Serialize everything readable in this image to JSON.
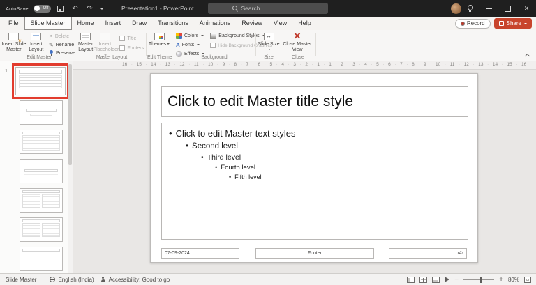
{
  "titlebar": {
    "autosave_label": "AutoSave",
    "autosave_state": "Off",
    "document_title": "Presentation1 - PowerPoint",
    "search_placeholder": "Search"
  },
  "tabs": {
    "items": [
      "File",
      "Slide Master",
      "Home",
      "Insert",
      "Draw",
      "Transitions",
      "Animations",
      "Review",
      "View",
      "Help"
    ],
    "active": "Slide Master",
    "record_label": "Record",
    "share_label": "Share"
  },
  "ribbon": {
    "edit_master": {
      "label": "Edit Master",
      "insert_slide_master": "Insert Slide Master",
      "insert_layout": "Insert Layout",
      "delete": "Delete",
      "rename": "Rename",
      "preserve": "Preserve"
    },
    "master_layout": {
      "label": "Master Layout",
      "master_layout": "Master Layout",
      "insert_placeholder": "Insert Placeholder",
      "title_checkbox": "Title",
      "footers_checkbox": "Footers"
    },
    "edit_theme": {
      "label": "Edit Theme",
      "themes": "Themes"
    },
    "background": {
      "label": "Background",
      "colors": "Colors",
      "fonts": "Fonts",
      "effects": "Effects",
      "background_styles": "Background Styles",
      "hide_background_graphics": "Hide Background Graphics"
    },
    "size": {
      "label": "Size",
      "slide_size": "Slide Size"
    },
    "close": {
      "label": "Close",
      "close_master_view": "Close Master View"
    }
  },
  "sidebar": {
    "selected_slide_number": "1",
    "thumbnails": [
      {
        "kind": "master",
        "selected": true
      },
      {
        "kind": "title",
        "selected": false
      },
      {
        "kind": "content",
        "selected": false
      },
      {
        "kind": "section",
        "selected": false
      },
      {
        "kind": "two-content",
        "selected": false
      },
      {
        "kind": "comparison",
        "selected": false
      },
      {
        "kind": "title-only",
        "selected": false
      }
    ]
  },
  "ruler": {
    "numbers": [
      16,
      15,
      14,
      13,
      12,
      11,
      10,
      9,
      8,
      7,
      6,
      5,
      4,
      3,
      2,
      1,
      1,
      2,
      3,
      4,
      5,
      6,
      7,
      8,
      9,
      10,
      11,
      12,
      13,
      14,
      15,
      16
    ],
    "dot": "·"
  },
  "slide": {
    "title_placeholder": "Click to edit Master title style",
    "bullet_glyph": "•",
    "body_levels": [
      "Click to edit Master text styles",
      "Second level",
      "Third level",
      "Fourth level",
      "Fifth level"
    ],
    "date": "07-09-2024",
    "footer": "Footer",
    "slide_number_symbol": "‹#›"
  },
  "statusbar": {
    "view_label": "Slide Master",
    "language": "English (India)",
    "accessibility": "Accessibility: Good to go",
    "zoom_out": "−",
    "zoom_in": "+",
    "zoom": "80%"
  },
  "colors": {
    "share_button": "#c8442c",
    "close_master_x": "#c0392b",
    "selection_highlight": "#e23c2e",
    "titlebar_bg": "#1f1f1f"
  }
}
